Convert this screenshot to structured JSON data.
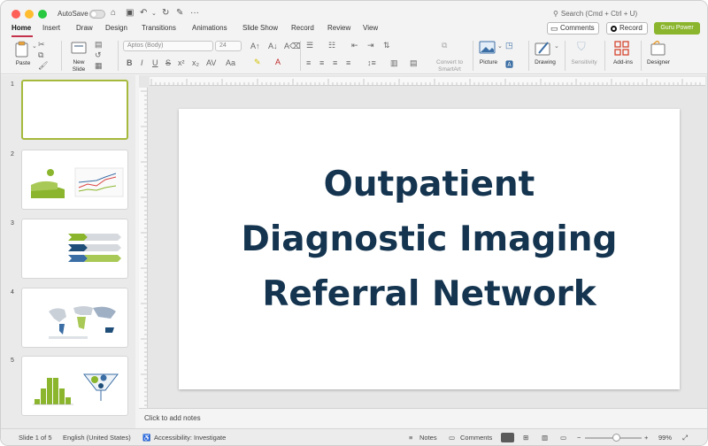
{
  "titlebar": {
    "autosave_label": "AutoSave",
    "search_placeholder": "Search (Cmd + Ctrl + U)"
  },
  "tabs": [
    {
      "label": "Home",
      "active": true
    },
    {
      "label": "Insert"
    },
    {
      "label": "Draw"
    },
    {
      "label": "Design"
    },
    {
      "label": "Transitions"
    },
    {
      "label": "Animations"
    },
    {
      "label": "Slide Show"
    },
    {
      "label": "Record"
    },
    {
      "label": "Review"
    },
    {
      "label": "View"
    }
  ],
  "actions": {
    "comments_label": "Comments",
    "record_label": "Record",
    "guru_label": "Guru Power"
  },
  "ribbon": {
    "paste_label": "Paste",
    "new_slide_label": "New Slide",
    "font_name": "Aptos (Body)",
    "font_size": "24",
    "convert_label": "Convert to SmartArt",
    "picture_label": "Picture",
    "drawing_label": "Drawing",
    "sensitivity_label": "Sensitivity",
    "addins_label": "Add-ins",
    "designer_label": "Designer"
  },
  "thumbnails": [
    {
      "number": "1"
    },
    {
      "number": "2"
    },
    {
      "number": "3"
    },
    {
      "number": "4"
    },
    {
      "number": "5"
    }
  ],
  "slide": {
    "title_line1": "Outpatient",
    "title_line2": "Diagnostic Imaging",
    "title_line3": "Referral Network"
  },
  "notes_placeholder": "Click to add notes",
  "status": {
    "slide_position": "Slide 1 of 5",
    "language": "English (United States)",
    "accessibility": "Accessibility: Investigate",
    "notes_label": "Notes",
    "comments_label": "Comments",
    "zoom": "99%",
    "zoom_fraction": 0.55
  },
  "colors": {
    "accent_tab": "#c4314b",
    "guru_green": "#8ab52c",
    "slide_title": "#14344f",
    "selected_thumb": "#a6b93c"
  }
}
